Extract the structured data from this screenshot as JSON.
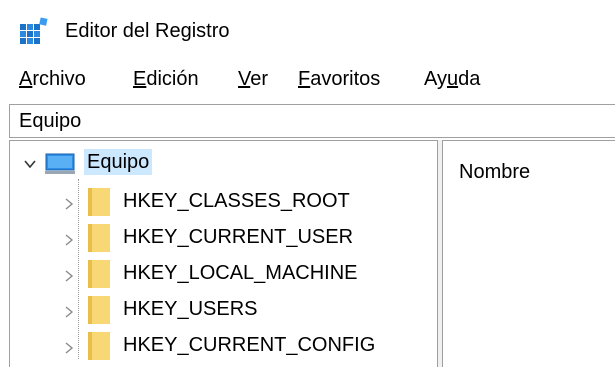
{
  "window": {
    "title": "Editor del Registro",
    "icon": "registry-editor-icon"
  },
  "menu": {
    "items": [
      {
        "label": "Archivo",
        "accel": "A"
      },
      {
        "label": "Edición",
        "accel": "E"
      },
      {
        "label": "Ver",
        "accel": "V"
      },
      {
        "label": "Favoritos",
        "accel": "F"
      },
      {
        "label": "Ayuda",
        "accel": "u"
      }
    ]
  },
  "address": {
    "path": "Equipo"
  },
  "tree": {
    "root": {
      "label": "Equipo",
      "expanded": true,
      "selected": true,
      "icon": "computer-icon"
    },
    "keys": [
      {
        "label": "HKEY_CLASSES_ROOT"
      },
      {
        "label": "HKEY_CURRENT_USER"
      },
      {
        "label": "HKEY_LOCAL_MACHINE"
      },
      {
        "label": "HKEY_USERS"
      },
      {
        "label": "HKEY_CURRENT_CONFIG"
      }
    ]
  },
  "list": {
    "columns": [
      "Nombre"
    ]
  },
  "colors": {
    "selection": "#cce8ff",
    "folder": "#f8d775",
    "border": "#a0a0a0"
  }
}
